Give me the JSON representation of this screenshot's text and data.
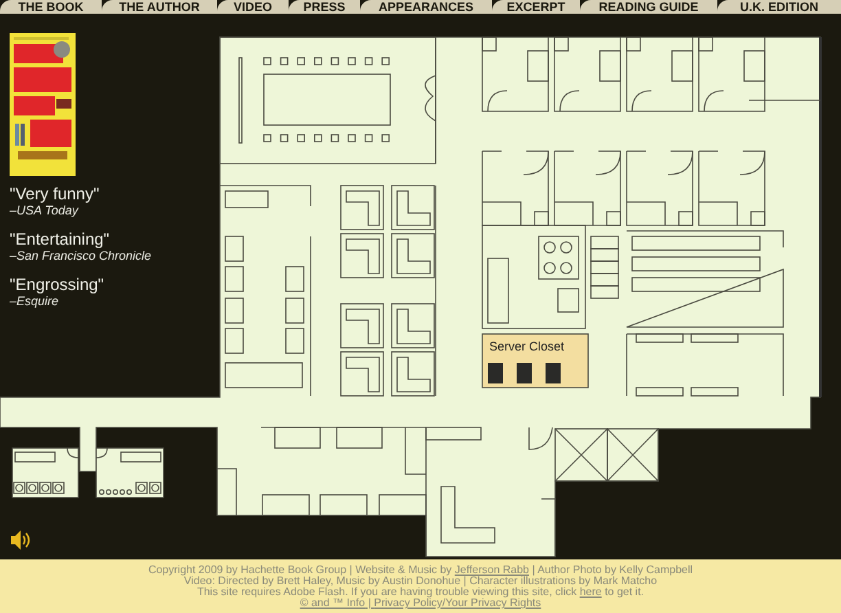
{
  "nav": {
    "tabs": [
      {
        "label": "THE BOOK"
      },
      {
        "label": "THE AUTHOR"
      },
      {
        "label": "VIDEO"
      },
      {
        "label": "PRESS"
      },
      {
        "label": "APPEARANCES"
      },
      {
        "label": "EXCERPT"
      },
      {
        "label": "READING GUIDE"
      },
      {
        "label": "U.K. EDITION"
      }
    ]
  },
  "reviews": [
    {
      "quote": "\"Very funny\"",
      "source": "–USA Today"
    },
    {
      "quote": "\"Entertaining\"",
      "source": "–San Francisco Chronicle"
    },
    {
      "quote": "\"Engrossing\"",
      "source": "–Esquire"
    }
  ],
  "floor_plan": {
    "room_label": "Server Closet"
  },
  "footer": {
    "lines": [
      [
        {
          "kind": "text",
          "text": "Copyright 2009 by Hachette Book Group | Website & Music by "
        },
        {
          "kind": "link",
          "text": "Jefferson Rabb"
        },
        {
          "kind": "text",
          "text": " | Author Photo by Kelly Campbell"
        }
      ],
      [
        {
          "kind": "text",
          "text": "Video: Directed by Brett Haley, Music by Austin Donohue | Character illustrations by Mark Matcho"
        }
      ],
      [
        {
          "kind": "text",
          "text": "This site requires Adobe Flash. If you are having trouble viewing this site, click "
        },
        {
          "kind": "link",
          "text": "here"
        },
        {
          "kind": "text",
          "text": " to get it."
        }
      ],
      [
        {
          "kind": "link",
          "text": "© and ™ Info"
        },
        {
          "kind": "link",
          "text": " | "
        },
        {
          "kind": "link",
          "text": "Privacy Policy/Your Privacy Rights"
        }
      ]
    ]
  }
}
